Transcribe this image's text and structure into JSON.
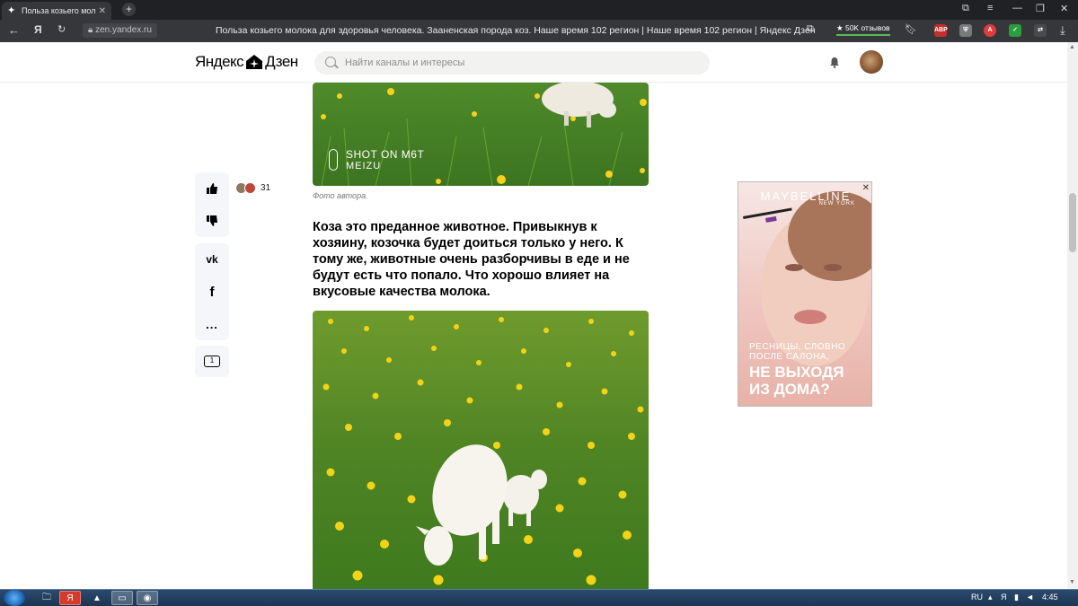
{
  "browser": {
    "tab_title": "Польза козьего молока",
    "tab_close": "✕",
    "new_tab": "+",
    "url_host": "zen.yandex.ru",
    "page_title": "Польза козьего молока для здоровья человека. Зааненская порода коз. Наше время 102 регион | Наше время 102 регион | Яндекс Дзен",
    "reviews_label": "★ 50K отзывов",
    "extensions": [
      {
        "name": "adblock-plus-icon",
        "label": "ABP",
        "color": "#c4302b"
      },
      {
        "name": "shield-icon",
        "label": "",
        "color": "#7a7a7a"
      },
      {
        "name": "antivirus-icon",
        "label": "A",
        "color": "#e23b3b"
      },
      {
        "name": "protect-icon",
        "label": "",
        "color": "#2a9d3f"
      },
      {
        "name": "translate-icon",
        "label": "",
        "color": "#4a4a4a"
      }
    ]
  },
  "dzen": {
    "logo_left": "Яндекс",
    "logo_right": "Дзен",
    "search_placeholder": "Найти каналы и интересы"
  },
  "article": {
    "photo_caption": "Фото автора.",
    "watermark_line1": "SHOT ON M6T",
    "watermark_line2": "MEIZU",
    "paragraph": "Коза это преданное животное. Привыкнув к хозяину, козочка будет доиться только у него. К тому же, животные очень разборчивы в еде и не будут есть что попало. Что хорошо влияет на вкусовые качества молока.",
    "likes_count": "31",
    "comments_count": "1",
    "share_more": "..."
  },
  "ad": {
    "brand": "MAYBELLINE",
    "brand_sub": "NEW YORK",
    "line1": "РЕСНИЦЫ, СЛОВНО ПОСЛЕ САЛОНА,",
    "line2": "НЕ ВЫХОДЯ ИЗ ДОМА?",
    "close": "✕"
  },
  "taskbar": {
    "lang": "RU",
    "time": "4:45"
  }
}
